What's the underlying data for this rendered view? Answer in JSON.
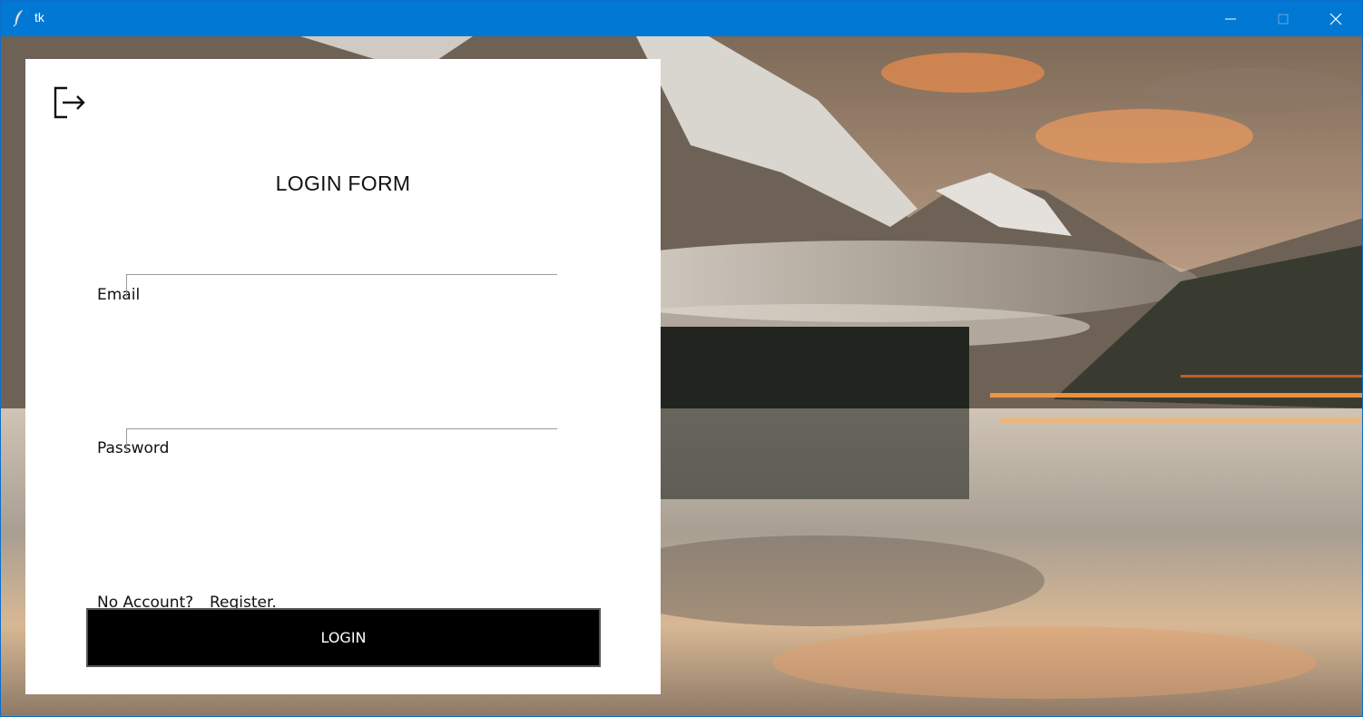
{
  "window": {
    "title": "tk",
    "app_icon": "feather-icon",
    "controls": [
      "minimize-icon",
      "maximize-icon",
      "close-icon"
    ]
  },
  "background": {
    "description_icon": "mountain-lake-landscape"
  },
  "form": {
    "logout_icon": "logout-icon",
    "title": "LOGIN FORM",
    "email_label": "Email",
    "email_value": "",
    "password_label": "Password",
    "password_value": "",
    "no_account_text": "No Account?",
    "register_link": "Register.",
    "login_button": "LOGIN"
  },
  "colors": {
    "titlebar": "#0078d4",
    "panel": "#ffffff",
    "button": "#000000",
    "button_text": "#ffffff"
  }
}
